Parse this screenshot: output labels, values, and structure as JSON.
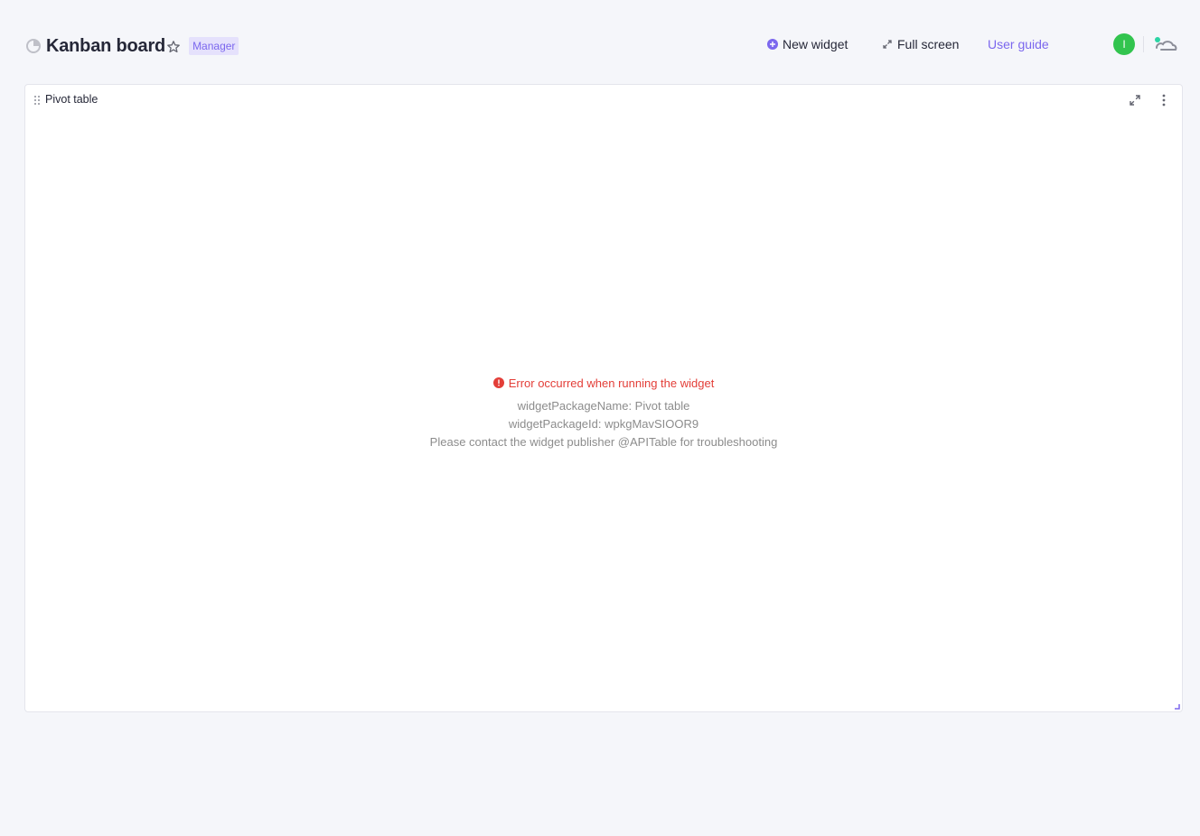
{
  "header": {
    "title": "Kanban board",
    "role_badge": "Manager",
    "new_widget_label": "New widget",
    "full_screen_label": "Full screen",
    "user_guide_label": "User guide",
    "avatar_initial": "I"
  },
  "widget": {
    "title": "Pivot table",
    "error": {
      "title": "Error occurred when running the widget",
      "package_name": "widgetPackageName: Pivot table",
      "package_id": "widgetPackageId: wpkgMavSIOOR9",
      "contact": "Please contact the widget publisher @APITable for troubleshooting"
    }
  },
  "colors": {
    "accent": "#7b67ee",
    "error": "#e33e38",
    "avatar": "#32c44e",
    "background": "#f5f6fa"
  },
  "icons": {
    "dashboard": "dashboard-icon",
    "star": "star-icon",
    "add": "add-circle-icon",
    "fullscreen": "fullscreen-icon",
    "cloud": "cloud-icon",
    "drag": "drag-handle-icon",
    "expand": "expand-icon",
    "more": "more-vertical-icon",
    "warning": "warning-circle-icon"
  }
}
